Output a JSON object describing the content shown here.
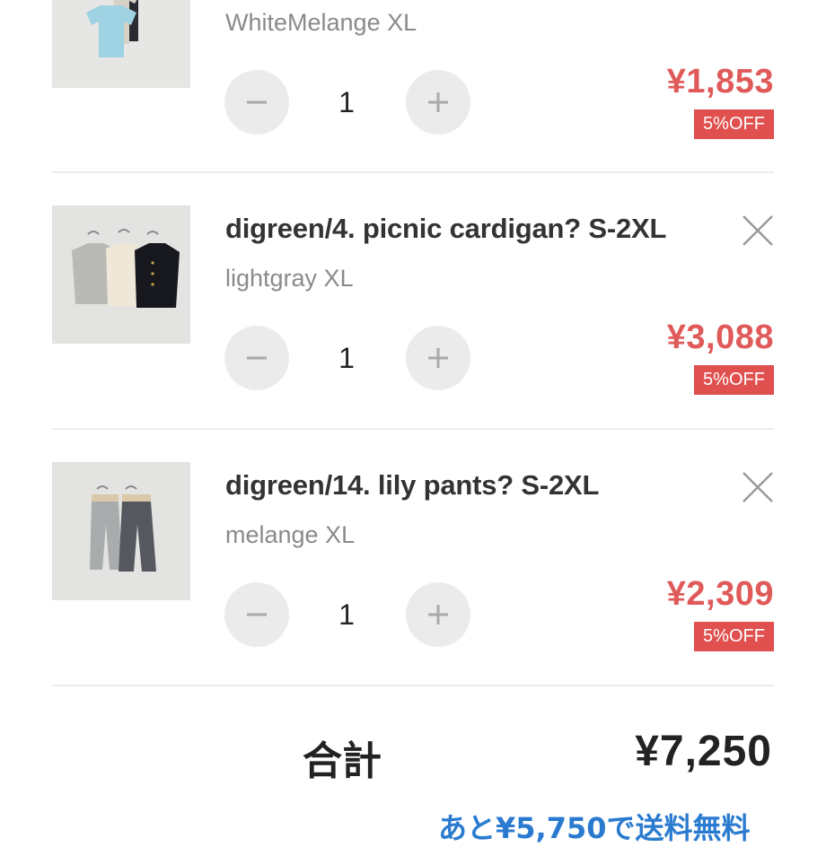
{
  "cart": {
    "items": [
      {
        "title": "",
        "variant": "WhiteMelange XL",
        "quantity": "1",
        "price": "¥1,853",
        "discount": "5%OFF",
        "image_icon": "product-photo-tshirts"
      },
      {
        "title": "digreen/4. picnic cardigan? S-2XL",
        "variant": "lightgray XL",
        "quantity": "1",
        "price": "¥3,088",
        "discount": "5%OFF",
        "image_icon": "product-photo-cardigans"
      },
      {
        "title": "digreen/14. lily pants? S-2XL",
        "variant": "melange XL",
        "quantity": "1",
        "price": "¥2,309",
        "discount": "5%OFF",
        "image_icon": "product-photo-pants"
      }
    ],
    "total_label": "合計",
    "total_value": "¥7,250",
    "free_shipping_note": "あと¥5,750で送料無料"
  },
  "colors": {
    "price_red": "#e05a5a",
    "badge_red": "#e0504f",
    "note_blue": "#2a7bd0",
    "button_gray": "#ebebeb"
  }
}
